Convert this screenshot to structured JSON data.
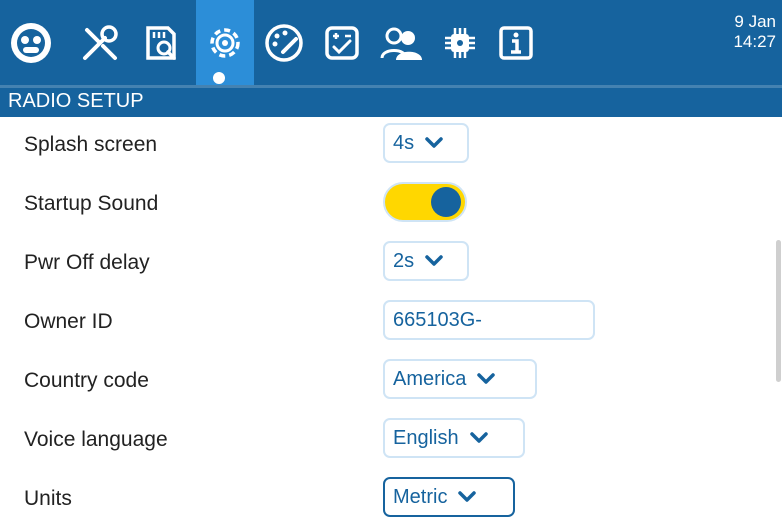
{
  "header": {
    "date": "9 Jan",
    "time": "14:27",
    "tabs": [
      {
        "name": "model-icon"
      },
      {
        "name": "tools-icon"
      },
      {
        "name": "sd-card-icon"
      },
      {
        "name": "gear-icon",
        "active": true
      },
      {
        "name": "theme-palette-icon"
      },
      {
        "name": "checklist-icon"
      },
      {
        "name": "users-icon"
      },
      {
        "name": "hardware-chip-icon"
      },
      {
        "name": "info-icon"
      }
    ]
  },
  "title": "RADIO SETUP",
  "settings": {
    "splash_screen": {
      "label": "Splash screen",
      "value": "4s"
    },
    "startup_sound": {
      "label": "Startup Sound",
      "enabled": true
    },
    "pwr_off_delay": {
      "label": "Pwr Off delay",
      "value": "2s"
    },
    "owner_id": {
      "label": "Owner ID",
      "value": "665103G-"
    },
    "country_code": {
      "label": "Country code",
      "value": "America"
    },
    "voice_language": {
      "label": "Voice language",
      "value": "English"
    },
    "units": {
      "label": "Units",
      "value": "Metric"
    }
  },
  "colors": {
    "header": "#16639e",
    "active_tab": "#2c8ed8",
    "toggle_on": "#ffd700",
    "value_text": "#16639e"
  }
}
